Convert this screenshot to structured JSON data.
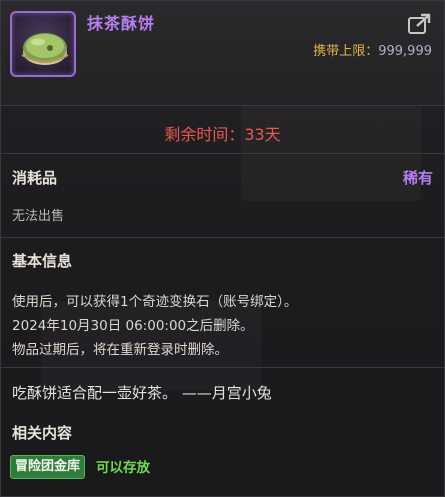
{
  "item": {
    "name": "抹茶酥饼",
    "icon": "matcha-cake-icon",
    "carry_limit_label": "携带上限：",
    "carry_limit_value": "999,999"
  },
  "remaining": {
    "text": "剩余时间：33天"
  },
  "meta": {
    "type": "消耗品",
    "rarity": "稀有",
    "sell_status": "无法出售"
  },
  "basic_info": {
    "title": "基本信息",
    "lines": [
      "使用后，可以获得1个奇迹变换石（账号绑定）。",
      "2024年10月30日 06:00:00之后删除。",
      "物品过期后，将在重新登录时删除。"
    ]
  },
  "flavor_text": "吃酥饼适合配一壶好茶。 ——月宫小兔",
  "related": {
    "title": "相关内容",
    "storage_button": "冒险团金库",
    "storage_status": "可以存放"
  },
  "colors": {
    "rarity_purple": "#b57ff0",
    "remaining_red": "#e6584f",
    "carry_gold": "#e2b34a",
    "storage_green": "#6fdc4a"
  }
}
